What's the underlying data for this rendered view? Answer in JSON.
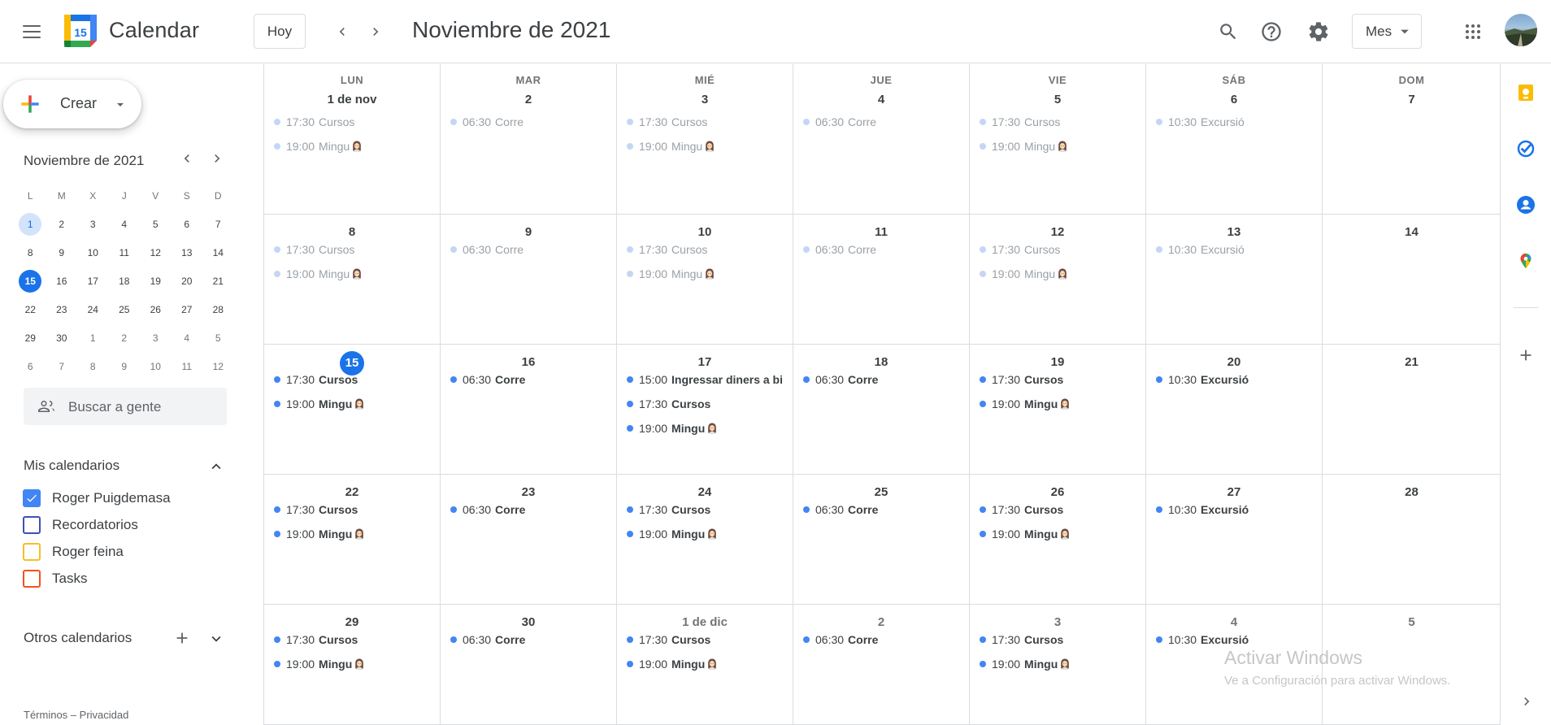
{
  "header": {
    "app_title": "Calendar",
    "logo_day": "15",
    "today_label": "Hoy",
    "month_title": "Noviembre de 2021",
    "view_label": "Mes"
  },
  "sidebar": {
    "create_label": "Crear",
    "mini_title": "Noviembre de 2021",
    "mini_weekdays": [
      "L",
      "M",
      "X",
      "J",
      "V",
      "S",
      "D"
    ],
    "mini_weeks": [
      [
        "1",
        "2",
        "3",
        "4",
        "5",
        "6",
        "7"
      ],
      [
        "8",
        "9",
        "10",
        "11",
        "12",
        "13",
        "14"
      ],
      [
        "15",
        "16",
        "17",
        "18",
        "19",
        "20",
        "21"
      ],
      [
        "22",
        "23",
        "24",
        "25",
        "26",
        "27",
        "28"
      ],
      [
        "29",
        "30",
        "1",
        "2",
        "3",
        "4",
        "5"
      ],
      [
        "6",
        "7",
        "8",
        "9",
        "10",
        "11",
        "12"
      ]
    ],
    "people_search_placeholder": "Buscar a gente",
    "my_calendars_title": "Mis calendarios",
    "my_calendars": [
      {
        "label": "Roger Puigdemasa",
        "color": "#4285f4",
        "checked": true
      },
      {
        "label": "Recordatorios",
        "color": "#3f51b5",
        "checked": false
      },
      {
        "label": "Roger feina",
        "color": "#f6bf26",
        "checked": false
      },
      {
        "label": "Tasks",
        "color": "#f4511e",
        "checked": false
      }
    ],
    "other_calendars_title": "Otros calendarios",
    "footer_terms": "Términos",
    "footer_sep": " – ",
    "footer_privacy": "Privacidad"
  },
  "month": {
    "weekdays": [
      "LUN",
      "MAR",
      "MIÉ",
      "JUE",
      "VIE",
      "SÁB",
      "DOM"
    ],
    "weeks": [
      [
        {
          "label": "1 de nov",
          "events": [
            {
              "time": "17:30",
              "title": "Cursos"
            },
            {
              "time": "19:00",
              "title": "Mingu",
              "emoji": true
            }
          ]
        },
        {
          "label": "2",
          "events": [
            {
              "time": "06:30",
              "title": "Corre"
            }
          ]
        },
        {
          "label": "3",
          "events": [
            {
              "time": "17:30",
              "title": "Cursos"
            },
            {
              "time": "19:00",
              "title": "Mingu",
              "emoji": true
            }
          ]
        },
        {
          "label": "4",
          "events": [
            {
              "time": "06:30",
              "title": "Corre"
            }
          ]
        },
        {
          "label": "5",
          "events": [
            {
              "time": "17:30",
              "title": "Cursos"
            },
            {
              "time": "19:00",
              "title": "Mingu",
              "emoji": true
            }
          ]
        },
        {
          "label": "6",
          "events": [
            {
              "time": "10:30",
              "title": "Excursió"
            }
          ]
        },
        {
          "label": "7",
          "events": []
        }
      ],
      [
        {
          "label": "8",
          "events": [
            {
              "time": "17:30",
              "title": "Cursos"
            },
            {
              "time": "19:00",
              "title": "Mingu",
              "emoji": true
            }
          ]
        },
        {
          "label": "9",
          "events": [
            {
              "time": "06:30",
              "title": "Corre"
            }
          ]
        },
        {
          "label": "10",
          "events": [
            {
              "time": "17:30",
              "title": "Cursos"
            },
            {
              "time": "19:00",
              "title": "Mingu",
              "emoji": true
            }
          ]
        },
        {
          "label": "11",
          "events": [
            {
              "time": "06:30",
              "title": "Corre"
            }
          ]
        },
        {
          "label": "12",
          "events": [
            {
              "time": "17:30",
              "title": "Cursos"
            },
            {
              "time": "19:00",
              "title": "Mingu",
              "emoji": true
            }
          ]
        },
        {
          "label": "13",
          "events": [
            {
              "time": "10:30",
              "title": "Excursió"
            }
          ]
        },
        {
          "label": "14",
          "events": []
        }
      ],
      [
        {
          "label": "15",
          "today": true,
          "events": [
            {
              "time": "17:30",
              "title": "Cursos"
            },
            {
              "time": "19:00",
              "title": "Mingu",
              "emoji": true
            }
          ]
        },
        {
          "label": "16",
          "events": [
            {
              "time": "06:30",
              "title": "Corre"
            }
          ]
        },
        {
          "label": "17",
          "events": [
            {
              "time": "15:00",
              "title": "Ingressar diners a bi"
            },
            {
              "time": "17:30",
              "title": "Cursos"
            },
            {
              "time": "19:00",
              "title": "Mingu",
              "emoji": true
            }
          ]
        },
        {
          "label": "18",
          "events": [
            {
              "time": "06:30",
              "title": "Corre"
            }
          ]
        },
        {
          "label": "19",
          "events": [
            {
              "time": "17:30",
              "title": "Cursos"
            },
            {
              "time": "19:00",
              "title": "Mingu",
              "emoji": true
            }
          ]
        },
        {
          "label": "20",
          "events": [
            {
              "time": "10:30",
              "title": "Excursió"
            }
          ]
        },
        {
          "label": "21",
          "events": []
        }
      ],
      [
        {
          "label": "22",
          "events": [
            {
              "time": "17:30",
              "title": "Cursos"
            },
            {
              "time": "19:00",
              "title": "Mingu",
              "emoji": true
            }
          ]
        },
        {
          "label": "23",
          "events": [
            {
              "time": "06:30",
              "title": "Corre"
            }
          ]
        },
        {
          "label": "24",
          "events": [
            {
              "time": "17:30",
              "title": "Cursos"
            },
            {
              "time": "19:00",
              "title": "Mingu",
              "emoji": true
            }
          ]
        },
        {
          "label": "25",
          "events": [
            {
              "time": "06:30",
              "title": "Corre"
            }
          ]
        },
        {
          "label": "26",
          "events": [
            {
              "time": "17:30",
              "title": "Cursos"
            },
            {
              "time": "19:00",
              "title": "Mingu",
              "emoji": true
            }
          ]
        },
        {
          "label": "27",
          "events": [
            {
              "time": "10:30",
              "title": "Excursió"
            }
          ]
        },
        {
          "label": "28",
          "events": []
        }
      ],
      [
        {
          "label": "29",
          "events": [
            {
              "time": "17:30",
              "title": "Cursos"
            },
            {
              "time": "19:00",
              "title": "Mingu",
              "emoji": true
            }
          ]
        },
        {
          "label": "30",
          "events": [
            {
              "time": "06:30",
              "title": "Corre"
            }
          ]
        },
        {
          "label": "1 de dic",
          "other_month": true,
          "events": [
            {
              "time": "17:30",
              "title": "Cursos"
            },
            {
              "time": "19:00",
              "title": "Mingu",
              "emoji": true
            }
          ]
        },
        {
          "label": "2",
          "other_month": true,
          "events": [
            {
              "time": "06:30",
              "title": "Corre"
            }
          ]
        },
        {
          "label": "3",
          "other_month": true,
          "events": [
            {
              "time": "17:30",
              "title": "Cursos"
            },
            {
              "time": "19:00",
              "title": "Mingu",
              "emoji": true
            }
          ]
        },
        {
          "label": "4",
          "other_month": true,
          "events": [
            {
              "time": "10:30",
              "title": "Excursió"
            }
          ]
        },
        {
          "label": "5",
          "other_month": true,
          "events": []
        }
      ]
    ]
  },
  "colors": {
    "accent": "#1a73e8",
    "event_dot": "#4285f4",
    "event_dot_past": "#c5d6f5",
    "border": "#dadce0"
  },
  "side_panel": {
    "icons": [
      "keep-icon",
      "tasks-icon",
      "contacts-icon",
      "maps-icon",
      "add-addon-icon"
    ]
  },
  "watermark": {
    "title": "Activar Windows",
    "subtitle": "Ve a Configuración para activar Windows."
  }
}
